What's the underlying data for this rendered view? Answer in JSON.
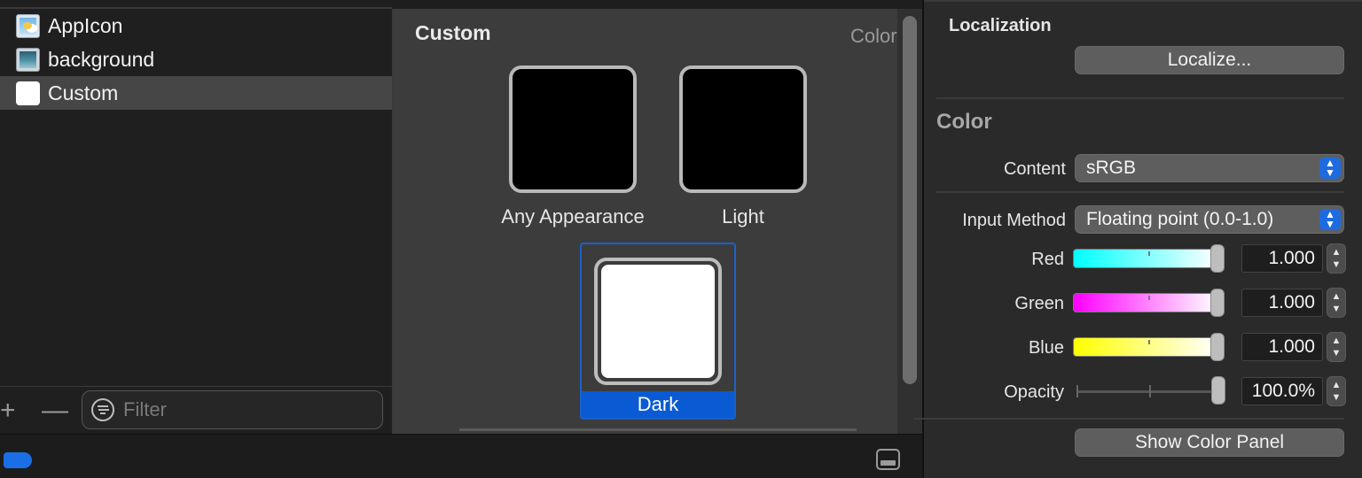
{
  "asset_list": {
    "items": [
      {
        "name": "AppIcon",
        "icon": "appicon-thumbnail",
        "selected": false
      },
      {
        "name": "background",
        "icon": "image-thumbnail",
        "selected": false
      },
      {
        "name": "Custom",
        "icon": "color-swatch-thumbnail",
        "selected": true
      }
    ],
    "add_label": "+",
    "remove_label": "—",
    "filter_placeholder": "Filter"
  },
  "canvas": {
    "title": "Custom",
    "kind_label": "Color Set",
    "swatches": [
      {
        "label": "Any Appearance",
        "color": "#000000"
      },
      {
        "label": "Light",
        "color": "#000000"
      },
      {
        "label": "Dark",
        "color": "#ffffff",
        "selected": true
      }
    ]
  },
  "inspector": {
    "localization": {
      "heading": "Localization",
      "button": "Localize..."
    },
    "color": {
      "heading": "Color",
      "content_label": "Content",
      "content_value": "sRGB",
      "input_method_label": "Input Method",
      "input_method_value": "Floating point (0.0-1.0)",
      "channels": [
        {
          "label": "Red",
          "value": "1.000",
          "level": 1.0
        },
        {
          "label": "Green",
          "value": "1.000",
          "level": 1.0
        },
        {
          "label": "Blue",
          "value": "1.000",
          "level": 1.0
        },
        {
          "label": "Opacity",
          "value": "100.0%",
          "level": 1.0
        }
      ],
      "show_panel_button": "Show Color Panel"
    }
  },
  "colors": {
    "accent": "#0a5bd3",
    "popup_chevron": "#1e6be0",
    "status_tag": "#1b6fe6"
  }
}
